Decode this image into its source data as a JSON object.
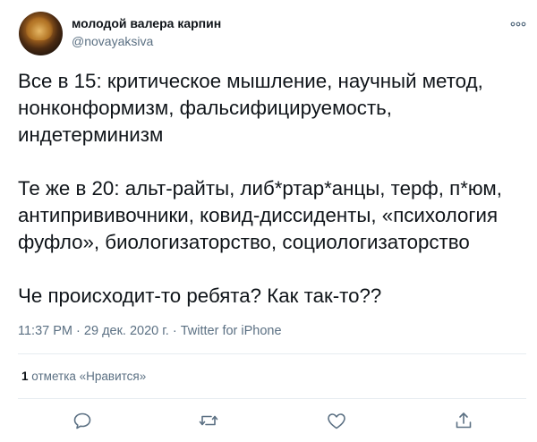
{
  "author": {
    "display_name": "молодой валера карпин",
    "handle": "@novayaksiva",
    "avatar": "profile-photo"
  },
  "tweet": {
    "paragraphs": [
      "Все в 15: критическое мышление, научный метод, нонконформизм, фальсифицируемость, индетерминизм",
      "Те же в 20: альт-райты, либ*ртар*анцы, терф, п*юм, антипрививочники, ковид-диссиденты, «психология фуфло», биологизаторство, социологизаторство",
      "Че происходит-то ребята? Как так-то??"
    ]
  },
  "meta": {
    "time": "11:37 PM",
    "separator": "·",
    "date": "29 дек. 2020 г.",
    "source": "Twitter for iPhone"
  },
  "likes": {
    "count": "1",
    "label": "отметка «Нравится»"
  },
  "actions": [
    "reply-icon",
    "retweet-icon",
    "like-icon",
    "share-icon"
  ],
  "colors": {
    "text": "#0f1419",
    "secondary": "#5b7083",
    "divider": "#e6ecf0",
    "icon": "#5b7083"
  }
}
